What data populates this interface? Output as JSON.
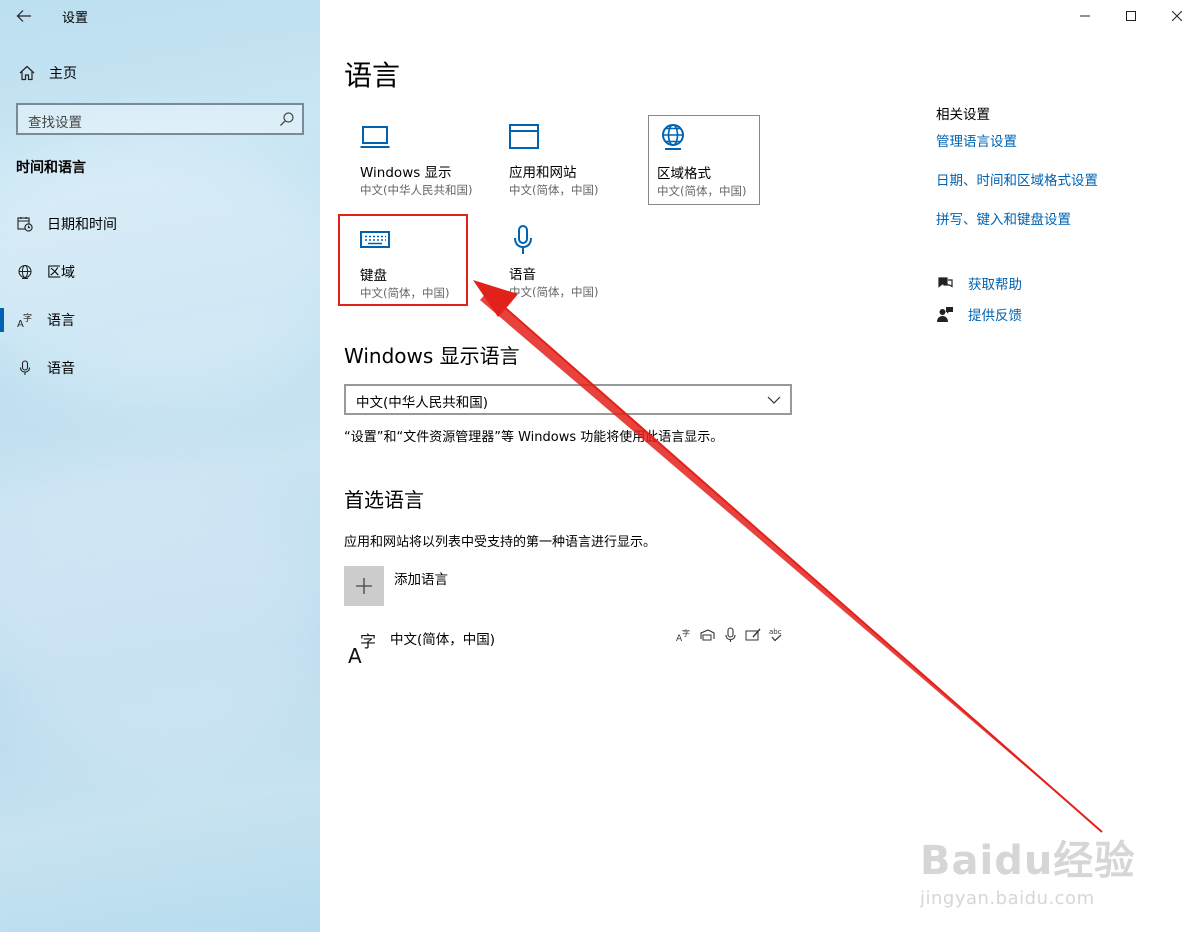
{
  "window": {
    "title": "设置"
  },
  "sidebar": {
    "home_label": "主页",
    "search_placeholder": "查找设置",
    "section_label": "时间和语言",
    "items": [
      {
        "label": "日期和时间",
        "icon": "calendar-clock-icon",
        "selected": false
      },
      {
        "label": "区域",
        "icon": "globe-icon",
        "selected": false
      },
      {
        "label": "语言",
        "icon": "language-icon",
        "selected": true
      },
      {
        "label": "语音",
        "icon": "microphone-icon",
        "selected": false
      }
    ]
  },
  "main": {
    "title": "语言",
    "tiles": [
      {
        "name": "Windows 显示",
        "sub": "中文(中华人民共和国)",
        "icon": "monitor-icon"
      },
      {
        "name": "应用和网站",
        "sub": "中文(简体，中国)",
        "icon": "browser-window-icon"
      },
      {
        "name": "区域格式",
        "sub": "中文(简体，中国)",
        "icon": "region-format-icon"
      },
      {
        "name": "键盘",
        "sub": "中文(简体，中国)",
        "icon": "keyboard-icon"
      },
      {
        "name": "语音",
        "sub": "中文(简体，中国)",
        "icon": "microphone-icon"
      }
    ],
    "display_language": {
      "heading": "Windows 显示语言",
      "selected": "中文(中华人民共和国)",
      "note": "“设置”和“文件资源管理器”等 Windows 功能将使用此语言显示。"
    },
    "preferred": {
      "heading": "首选语言",
      "description": "应用和网站将以列表中受支持的第一种语言进行显示。",
      "add_label": "添加语言",
      "languages": [
        {
          "name": "中文(简体，中国)"
        }
      ]
    }
  },
  "related": {
    "title": "相关设置",
    "links": [
      "管理语言设置",
      "日期、时间和区域格式设置",
      "拼写、键入和键盘设置"
    ],
    "help": "获取帮助",
    "feedback": "提供反馈"
  },
  "watermark": {
    "line1": "Baidu经验",
    "line2": "jingyan.baidu.com"
  },
  "colors": {
    "accent": "#0063b1",
    "annotation": "#e3211b"
  }
}
